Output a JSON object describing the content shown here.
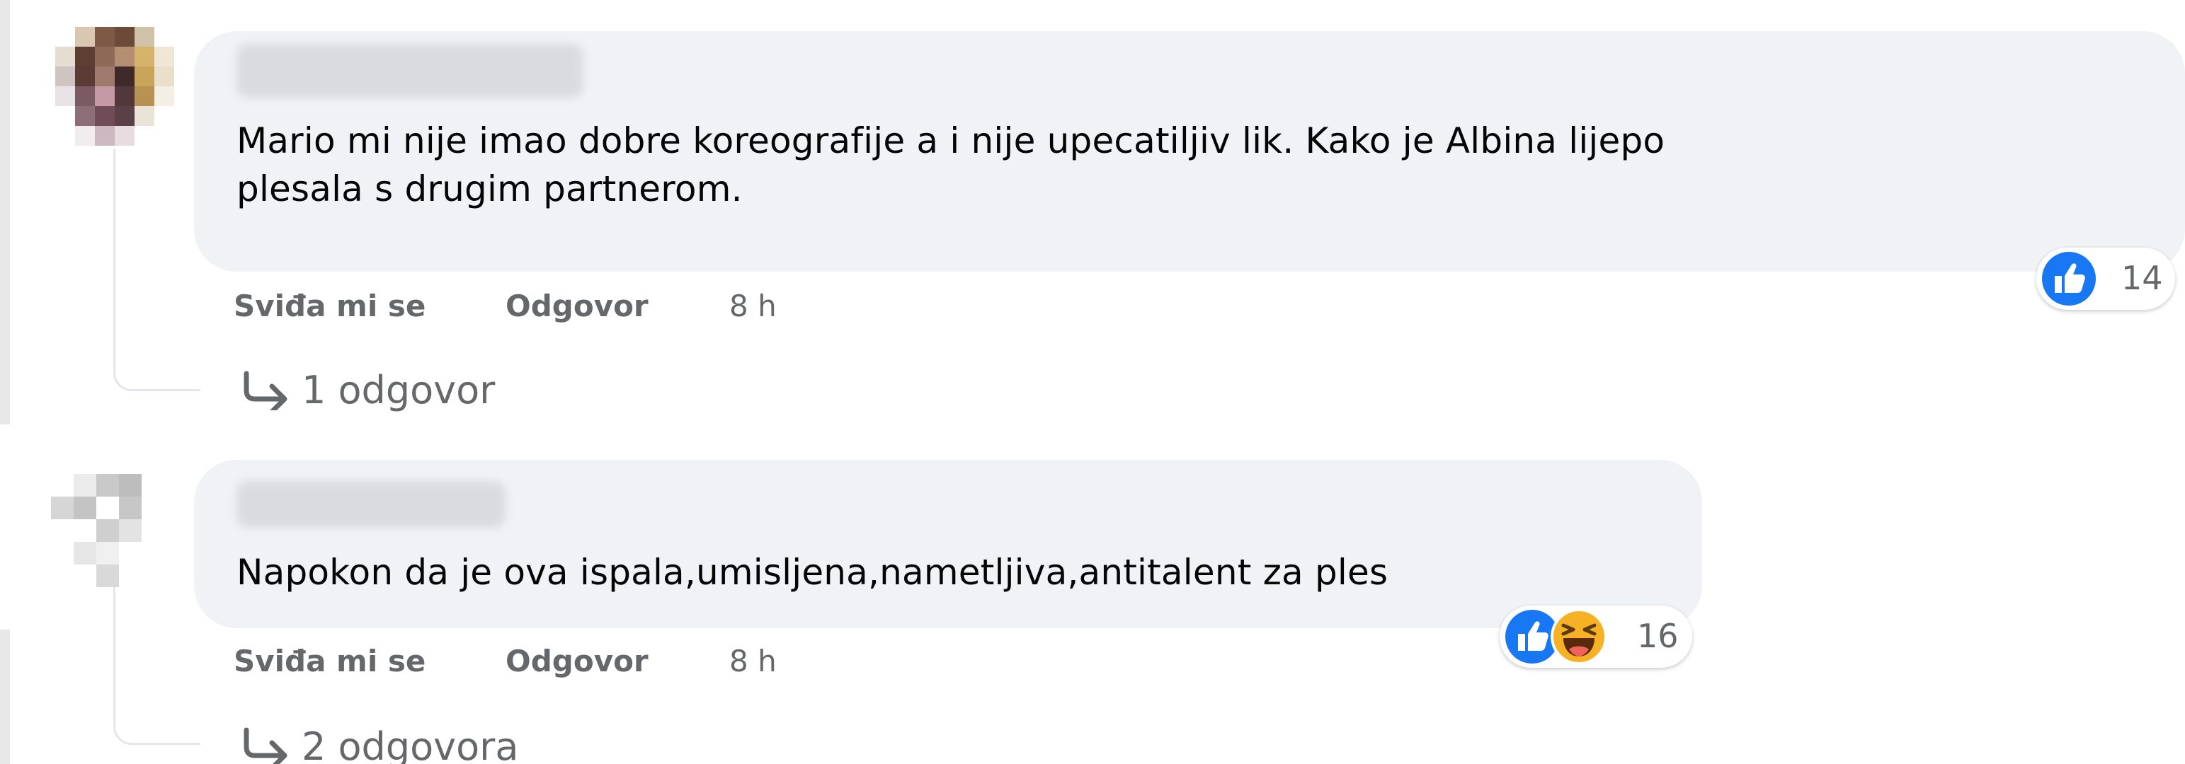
{
  "comments": [
    {
      "text": "Mario mi nije imao dobre koreografije a i nije upecatiljiv lik. Kako je Albina lijepo\nplesala s drugim partnerom.",
      "actions": {
        "like_label": "Sviđa mi se",
        "reply_label": "Odgovor",
        "time": "8 h"
      },
      "reactions": {
        "icons": [
          "like-icon"
        ],
        "count": "14"
      },
      "replies_label": "1 odgovor"
    },
    {
      "text": "Napokon da je ova ispala,umisljena,nametljiva,antitalent za ples",
      "actions": {
        "like_label": "Sviđa mi se",
        "reply_label": "Odgovor",
        "time": "8 h"
      },
      "reactions": {
        "icons": [
          "like-icon",
          "haha-icon"
        ],
        "count": "16"
      },
      "replies_label": "2 odgovora"
    }
  ],
  "colors": {
    "bubble": "#f0f2f5",
    "text": "#050505",
    "secondary_text": "#65676b",
    "like_blue": "#1877f2",
    "haha_yellow": "#f7b125"
  }
}
